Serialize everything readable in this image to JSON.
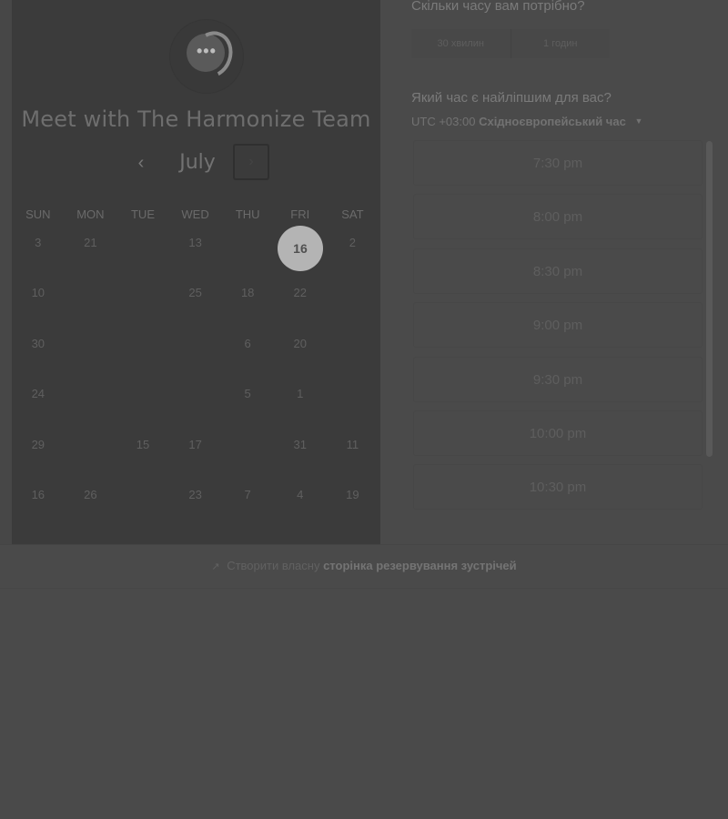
{
  "booking": {
    "title": "Meet with The Harmonize Team",
    "logo_glyph": "•••"
  },
  "calendar": {
    "month": "July",
    "prev_glyph": "‹",
    "next_glyph": "›",
    "weekdays": [
      "SUN",
      "MON",
      "TUE",
      "WED",
      "THU",
      "FRI",
      "SAT"
    ],
    "weeks": [
      [
        "3",
        "21",
        "",
        "13",
        "",
        "16",
        "2"
      ],
      [
        "10",
        "",
        "",
        "25",
        "18",
        "22",
        ""
      ],
      [
        "30",
        "",
        "",
        "",
        "6",
        "20",
        ""
      ],
      [
        "24",
        "",
        "",
        "",
        "5",
        "1",
        ""
      ],
      [
        "29",
        "",
        "15",
        "17",
        "",
        "31",
        "11"
      ],
      [
        "16",
        "26",
        "",
        "23",
        "7",
        "4",
        "19"
      ]
    ],
    "selected": "16"
  },
  "duration": {
    "heading": "Скільки часу вам потрібно?",
    "options": [
      "30 хвилин",
      "1 годин"
    ]
  },
  "time": {
    "heading": "Який час є найліпшим для вас?",
    "tz_offset": "UTC +03:00",
    "tz_name": "Східноєвропейський час",
    "tz_caret": "▼",
    "slots": [
      "7:30 pm",
      "8:00 pm",
      "8:30 pm",
      "9:00 pm",
      "9:30 pm",
      "10:00 pm",
      "10:30 pm"
    ]
  },
  "footer": {
    "icon": "↗",
    "prefix": "Створити власну",
    "link": "сторінка резервування зустрічей"
  }
}
